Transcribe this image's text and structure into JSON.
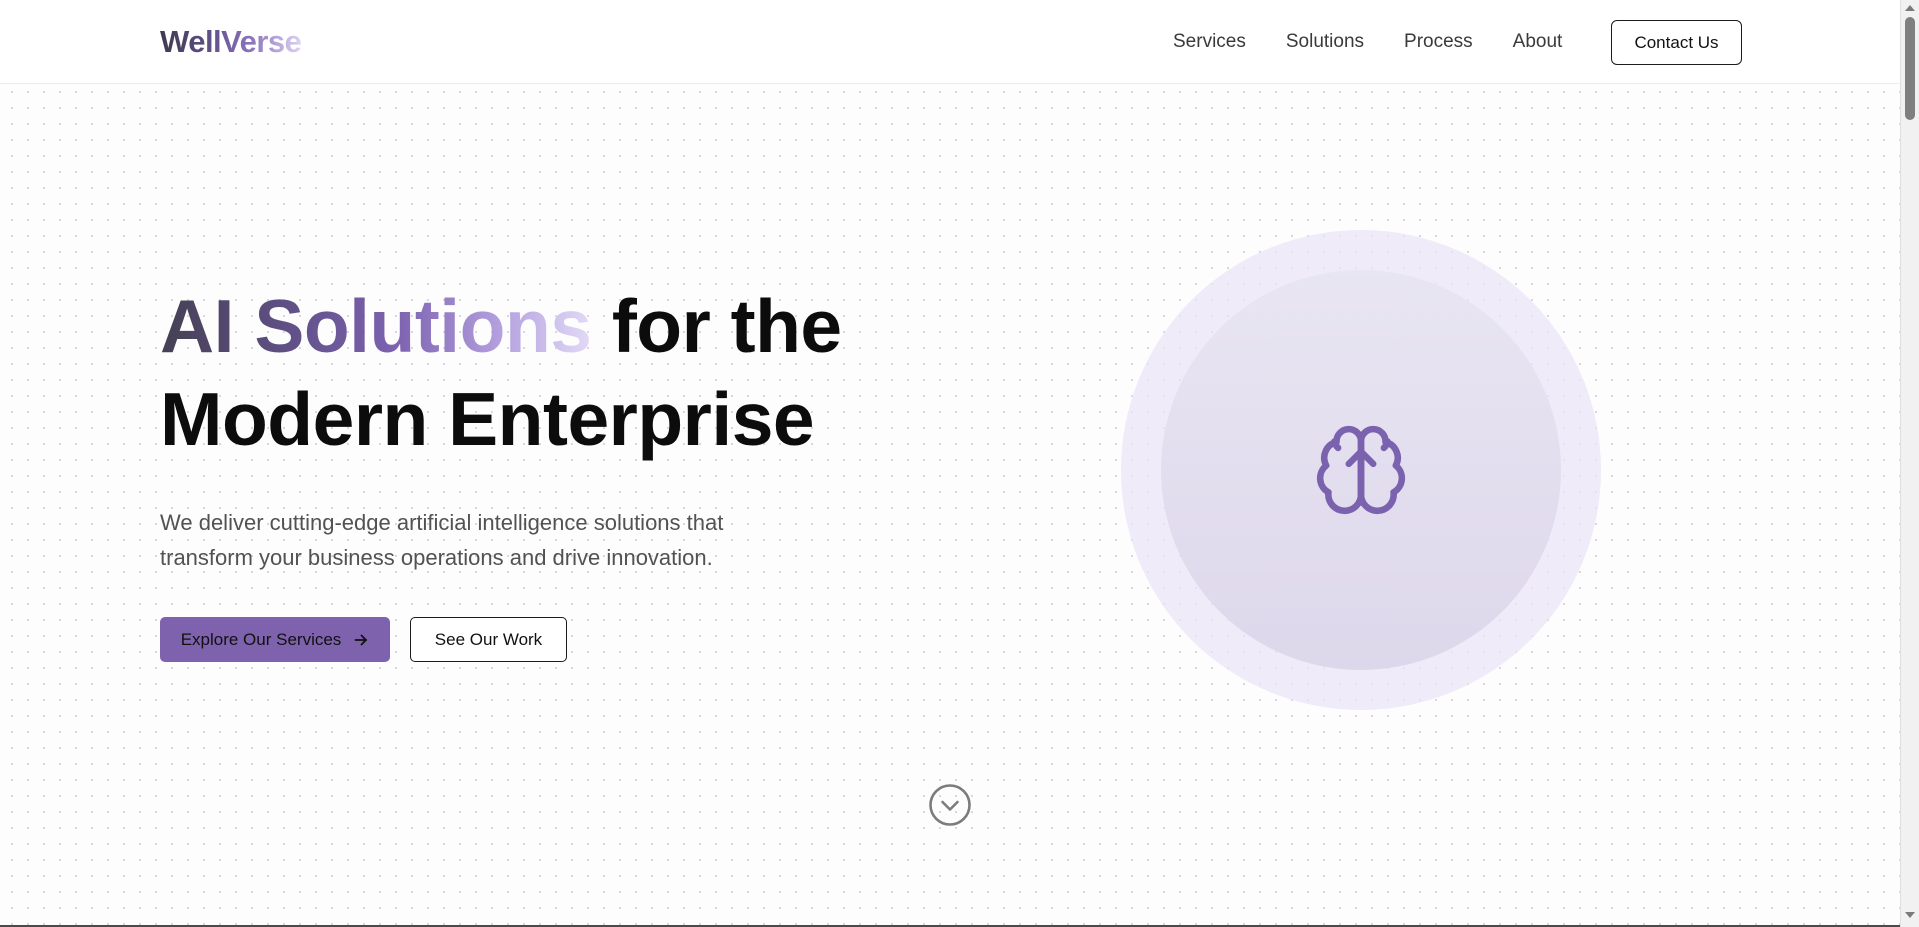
{
  "header": {
    "logo": "WellVerse",
    "nav": [
      {
        "label": "Services"
      },
      {
        "label": "Solutions"
      },
      {
        "label": "Process"
      },
      {
        "label": "About"
      }
    ],
    "contact_label": "Contact Us"
  },
  "hero": {
    "title_highlight": "AI Solutions",
    "title_rest_line1": " for the",
    "title_line2": "Modern Enterprise",
    "description": "We deliver cutting-edge artificial intelligence solutions that transform your business operations and drive innovation.",
    "primary_button": "Explore Our Services",
    "secondary_button": "See Our Work"
  },
  "icons": {
    "hero_visual": "brain-icon",
    "scroll_indicator": "chevron-down-circle-icon",
    "primary_button_arrow": "arrow-right-icon"
  },
  "colors": {
    "accent": "#7e62ad",
    "accent_light": "#e9e4f7",
    "text_dark": "#0c0c0c",
    "text_muted": "#525252"
  }
}
